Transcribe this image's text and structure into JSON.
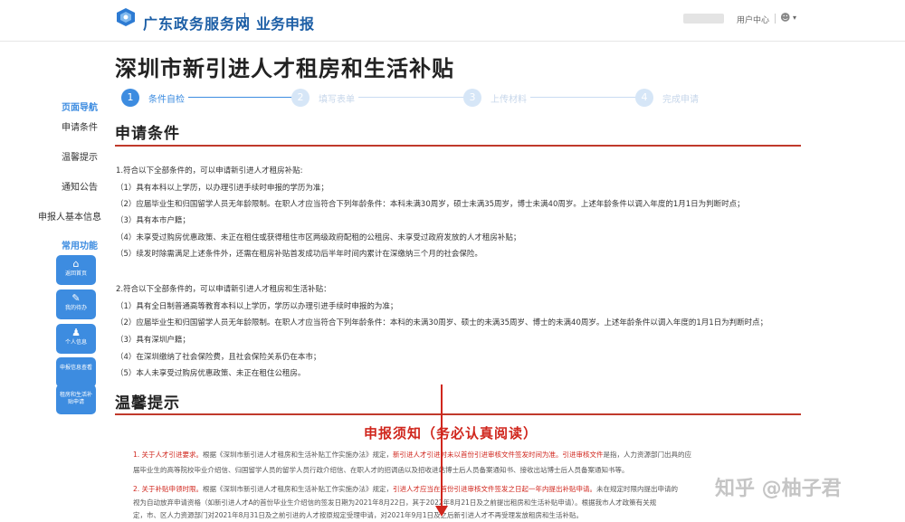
{
  "header": {
    "brand": "广东政务服务网",
    "subtitle": "业务申报",
    "user_center": "用户中心",
    "user_icon": "user-icon",
    "caret": "▾"
  },
  "page_title": "深圳市新引进人才租房和生活补贴",
  "steps": [
    {
      "num": "1",
      "label": "条件自检"
    },
    {
      "num": "2",
      "label": "填写表单"
    },
    {
      "num": "3",
      "label": "上传材料"
    },
    {
      "num": "4",
      "label": "完成申请"
    }
  ],
  "sidebar": {
    "nav_title": "页面导航",
    "items": [
      "申请条件",
      "温馨提示",
      "通知公告",
      "申报人基本信息"
    ],
    "func_title": "常用功能",
    "functions": [
      {
        "icon": "home-icon",
        "label": "返回首页"
      },
      {
        "icon": "edit-icon",
        "label": "我的待办"
      },
      {
        "icon": "person-icon",
        "label": "个人信息"
      },
      {
        "icon": "",
        "label": "申报信息查看"
      },
      {
        "icon": "",
        "label": "租房和生活补贴申请"
      }
    ]
  },
  "section1": {
    "title": "申请条件",
    "paragraphs": [
      "1.符合以下全部条件的，可以申请新引进人才租房补贴:",
      "（1）具有本科以上学历，以办理引进手续时申报的学历为准；",
      "（2）应届毕业生和归国留学人员无年龄限制。在职人才应当符合下列年龄条件：本科未满30周岁，硕士未满35周岁，博士未满40周岁。上述年龄条件以调入年度的1月1日为判断时点；",
      "（3）具有本市户籍；",
      "（4）未享受过购房优惠政策、未正在租住或获得租住市区两级政府配租的公租房、未享受过政府发放的人才租房补贴；",
      "（5）续发时除需满足上述条件外，还需在租房补贴首发成功后半年时间内累计在深缴纳三个月的社会保险。",
      "2.符合以下全部条件的，可以申请新引进人才租房和生活补贴：",
      "（1）具有全日制普通高等教育本科以上学历，学历以办理引进手续时申报的为准；",
      "（2）应届毕业生和归国留学人员无年龄限制。在职人才应当符合下列年龄条件：本科的未满30周岁、硕士的未满35周岁、博士的未满40周岁。上述年龄条件以调入年度的1月1日为判断时点；",
      "（3）具有深圳户籍；",
      "（4）在深圳缴纳了社会保险费，且社会保险关系仍在本市；",
      "（5）本人未享受过购房优惠政策、未正在租住公租房。"
    ]
  },
  "section2": {
    "title": "温馨提示"
  },
  "notice": {
    "title": "申报须知（务必认真阅读）",
    "lines": [
      {
        "red": "1. 关于人才引进要求。",
        "text": "根据《深圳市新引进人才租房和生活补贴工作实施办法》规定，",
        "red2": "新引进人才引进时未以首份引进审核文件签发时间为准。引进审核文件",
        "tail": "是指，人力资源部门出具的应"
      },
      {
        "red": "",
        "text": "届毕业生的高等院校毕业介绍信、归国留学人员的留学人员行政介绍信、在职人才的招调函以及招收进站博士后人员备案通知书、接收出站博士后人员备案通知书等。",
        "red2": "",
        "tail": ""
      },
      {
        "red": "2. 关于补贴申领时限。",
        "text": "根据《深圳市新引进人才租房和生活补贴工作实施办法》规定，",
        "red2": "引进人才应当在首份引进审核文件签发之日起一年内提出补贴申请。",
        "tail": "未在规定时限内提出申请的"
      },
      {
        "red": "",
        "text": "视为自动放弃申请资格（如新引进人才A的首份毕业生介绍信的签发日期为2021年8月22日，其于2022年8月21日及之前提出租房和生活补贴申请）。根据我市人才政策有关规",
        "red2": "",
        "tail": ""
      },
      {
        "red": "",
        "text": "定，市、区人力资源部门对2021年8月31日及之前引进的人才按原规定受理申请，对2021年9月1日及之后新引进人才不再受理发放租房和生活补贴。",
        "red2": "",
        "tail": ""
      }
    ]
  },
  "watermark": "知乎 @柚子君",
  "colors": {
    "accent": "#3d8ce0",
    "brand": "#1d5fa6",
    "section_rule": "#c0392b",
    "notice_red": "#d0261d"
  }
}
